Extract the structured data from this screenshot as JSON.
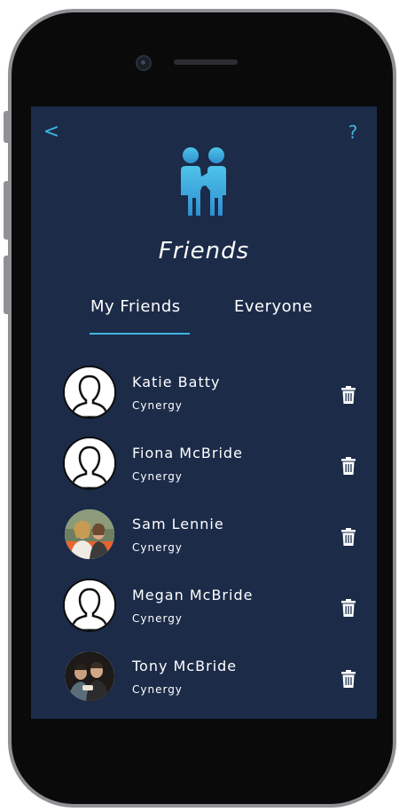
{
  "header": {
    "back_icon": "chevron-left-icon",
    "back_glyph": "<",
    "help_icon": "help-icon",
    "help_glyph": "?",
    "title": "Friends",
    "title_icon": "friends-icon"
  },
  "tabs": [
    {
      "label": "My Friends",
      "active": true
    },
    {
      "label": "Everyone",
      "active": false
    }
  ],
  "friends": [
    {
      "name": "Katie Batty",
      "subtitle": "Cynergy",
      "avatar": "default-avatar"
    },
    {
      "name": "Fiona McBride",
      "subtitle": "Cynergy",
      "avatar": "default-avatar"
    },
    {
      "name": "Sam Lennie",
      "subtitle": "Cynergy",
      "avatar": "photo"
    },
    {
      "name": "Megan McBride",
      "subtitle": "Cynergy",
      "avatar": "default-avatar"
    },
    {
      "name": "Tony McBride",
      "subtitle": "Cynergy",
      "avatar": "photo"
    }
  ],
  "colors": {
    "screen_bg": "#1b2b48",
    "accent": "#3fb6e0",
    "text": "#ffffff",
    "phone_frame": "#0a0a0a"
  },
  "row_action_icon": "trash-icon"
}
